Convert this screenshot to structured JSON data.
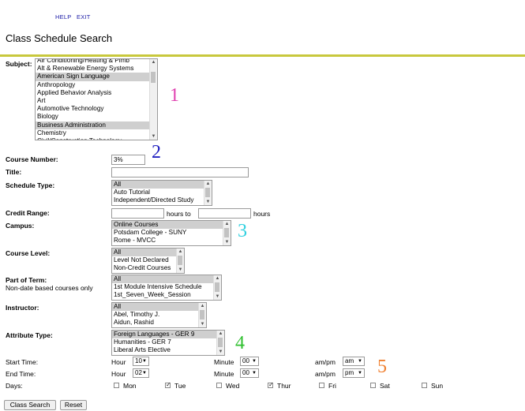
{
  "top_links": {
    "help": "HELP",
    "exit": "EXIT"
  },
  "page_title": "Class Schedule Search",
  "subject": {
    "label": "Subject:",
    "options": [
      {
        "text": "Air Conditioning/Heating & Plmb",
        "selected": false
      },
      {
        "text": "Alt & Renewable Energy Systems",
        "selected": false
      },
      {
        "text": "American Sign Language",
        "selected": true
      },
      {
        "text": "Anthropology",
        "selected": false
      },
      {
        "text": "Applied Behavior Analysis",
        "selected": false
      },
      {
        "text": "Art",
        "selected": false
      },
      {
        "text": "Automotive Technology",
        "selected": false
      },
      {
        "text": "Biology",
        "selected": false
      },
      {
        "text": "Business Administration",
        "selected": true
      },
      {
        "text": "Chemistry",
        "selected": false
      },
      {
        "text": "Civil/Construction Technology",
        "selected": false
      }
    ]
  },
  "course_number": {
    "label": "Course Number:",
    "value": "3%"
  },
  "title_field": {
    "label": "Title:",
    "value": ""
  },
  "schedule_type": {
    "label": "Schedule Type:",
    "options": [
      {
        "text": "All",
        "selected": true
      },
      {
        "text": "Auto Tutorial",
        "selected": false
      },
      {
        "text": "Independent/Directed Study",
        "selected": false
      }
    ]
  },
  "credit_range": {
    "label": "Credit Range:",
    "from": "",
    "to": "",
    "hours_to": "hours to",
    "hours": "hours"
  },
  "campus": {
    "label": "Campus:",
    "options": [
      {
        "text": "Online Courses",
        "selected": true
      },
      {
        "text": "Potsdam College - SUNY",
        "selected": false
      },
      {
        "text": "Rome - MVCC",
        "selected": false
      }
    ]
  },
  "course_level": {
    "label": "Course Level:",
    "options": [
      {
        "text": "All",
        "selected": true
      },
      {
        "text": "Level Not Declared",
        "selected": false
      },
      {
        "text": "Non-Credit Courses",
        "selected": false
      }
    ]
  },
  "part_of_term": {
    "label": "Part of Term:",
    "note": "Non-date based courses only",
    "options": [
      {
        "text": "All",
        "selected": true
      },
      {
        "text": "1st Module Intensive Schedule",
        "selected": false
      },
      {
        "text": "1st_Seven_Week_Session",
        "selected": false
      }
    ]
  },
  "instructor": {
    "label": "Instructor:",
    "options": [
      {
        "text": "All",
        "selected": true
      },
      {
        "text": "Abel, Timothy J.",
        "selected": false
      },
      {
        "text": "Aidun, Rashid",
        "selected": false
      }
    ]
  },
  "attribute_type": {
    "label": "Attribute Type:",
    "options": [
      {
        "text": "Foreign Languages - GER 9",
        "selected": true
      },
      {
        "text": "Humanities - GER 7",
        "selected": false
      },
      {
        "text": "Liberal Arts Elective",
        "selected": false
      }
    ]
  },
  "start_time": {
    "label": "Start Time:",
    "hour_label": "Hour",
    "hour": "10",
    "minute_label": "Minute",
    "minute": "00",
    "ampm_label": "am/pm",
    "ampm": "am"
  },
  "end_time": {
    "label": "End Time:",
    "hour_label": "Hour",
    "hour": "02",
    "minute_label": "Minute",
    "minute": "00",
    "ampm_label": "am/pm",
    "ampm": "pm"
  },
  "days": {
    "label": "Days:",
    "items": [
      {
        "label": "Mon",
        "checked": false
      },
      {
        "label": "Tue",
        "checked": true
      },
      {
        "label": "Wed",
        "checked": false
      },
      {
        "label": "Thur",
        "checked": true
      },
      {
        "label": "Fri",
        "checked": false
      },
      {
        "label": "Sat",
        "checked": false
      },
      {
        "label": "Sun",
        "checked": false
      }
    ]
  },
  "buttons": {
    "search": "Class Search",
    "reset": "Reset"
  },
  "annotations": [
    {
      "text": "1",
      "color": "#e040b0"
    },
    {
      "text": "2",
      "color": "#2020c0"
    },
    {
      "text": "3",
      "color": "#30d0e0"
    },
    {
      "text": "4",
      "color": "#30c030"
    },
    {
      "text": "5",
      "color": "#f08030"
    }
  ]
}
